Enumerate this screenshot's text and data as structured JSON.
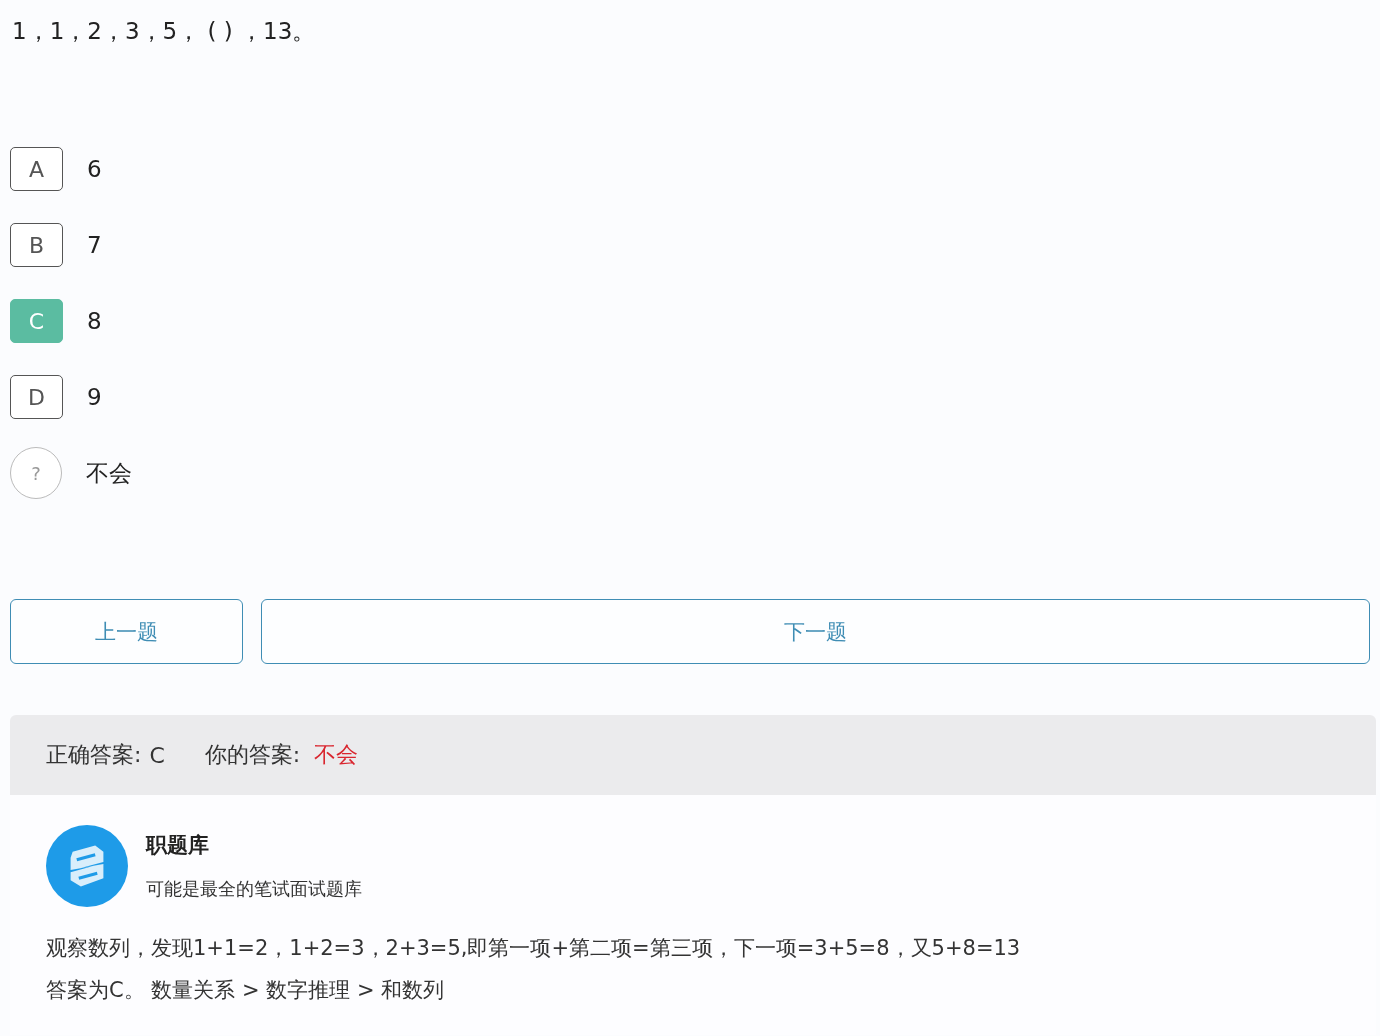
{
  "question": "1，1，2，3，5，  ( ) ，13。",
  "options": [
    {
      "kind": "letter",
      "marker": "A",
      "text": "6",
      "correct": false
    },
    {
      "kind": "letter",
      "marker": "B",
      "text": "7",
      "correct": false
    },
    {
      "kind": "letter",
      "marker": "C",
      "text": "8",
      "correct": true
    },
    {
      "kind": "letter",
      "marker": "D",
      "text": "9",
      "correct": false
    },
    {
      "kind": "unknown",
      "marker": "?",
      "text": "不会",
      "correct": false
    }
  ],
  "buttons": {
    "previous": "上一题",
    "next": "下一题"
  },
  "result": {
    "correct_label": "正确答案:",
    "correct_value": "C",
    "your_label": "你的答案:",
    "your_value": "不会"
  },
  "source": {
    "name": "职题库",
    "tagline": "可能是最全的笔试面试题库"
  },
  "explanation": [
    "观察数列，发现1+1=2，1+2=3，2+3=5,即第一项+第二项=第三项，下一项=3+5=8，又5+8=13",
    "答案为C。 数量关系 > 数字推理 > 和数列"
  ]
}
